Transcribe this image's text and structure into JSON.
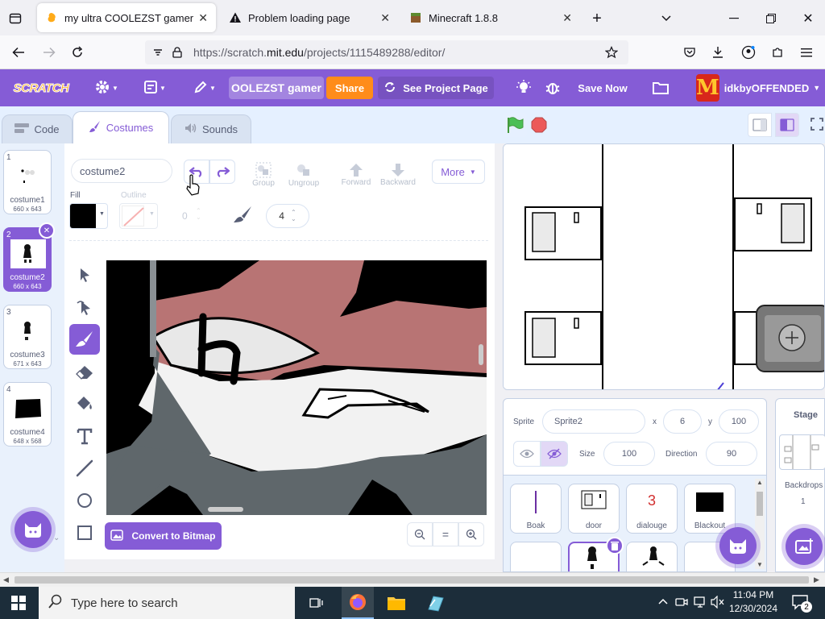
{
  "browser": {
    "tabs": [
      {
        "title": "my ultra COOLEZST gamer on S",
        "active": true
      },
      {
        "title": "Problem loading page",
        "active": false
      },
      {
        "title": "Minecraft 1.8.8",
        "active": false
      }
    ],
    "url_prefix": "https://scratch.",
    "url_domain": "mit.edu",
    "url_suffix": "/projects/1115489288/editor/"
  },
  "menu": {
    "logo": "SCRATCH",
    "project_title": "OOLEZST gamer",
    "share": "Share",
    "see_project_page": "See Project Page",
    "save_now": "Save Now",
    "username": "idkbyOFFENDED",
    "avatar_letter": "M"
  },
  "editor_tabs": {
    "code": "Code",
    "costumes": "Costumes",
    "sounds": "Sounds"
  },
  "costumes": [
    {
      "number": "1",
      "name": "costume1",
      "dims": "660 x 643"
    },
    {
      "number": "2",
      "name": "costume2",
      "dims": "660 x 643"
    },
    {
      "number": "3",
      "name": "costume3",
      "dims": "671 x 643"
    },
    {
      "number": "4",
      "name": "costume4",
      "dims": "648 x 568"
    }
  ],
  "paint": {
    "costume_name": "costume2",
    "group": "Group",
    "ungroup": "Ungroup",
    "forward": "Forward",
    "backward": "Backward",
    "more": "More",
    "fill_label": "Fill",
    "outline_label": "Outline",
    "outline_width": "0",
    "brush_size": "4",
    "convert": "Convert to Bitmap",
    "zoom_reset": "="
  },
  "sprite_info": {
    "sprite_label": "Sprite",
    "sprite_name": "Sprite2",
    "x_label": "x",
    "x": "6",
    "y_label": "y",
    "y": "100",
    "size_label": "Size",
    "size": "100",
    "direction_label": "Direction",
    "direction": "90"
  },
  "sprites": [
    {
      "name": "Boak"
    },
    {
      "name": "door"
    },
    {
      "name": "dialouge",
      "glyph": "3"
    },
    {
      "name": "Blackout"
    }
  ],
  "stage_panel": {
    "title": "Stage",
    "backdrops_label": "Backdrops",
    "backdrops_count": "1"
  },
  "taskbar": {
    "search_placeholder": "Type here to search",
    "time": "11:04 PM",
    "date": "12/30/2024",
    "notifications": "2"
  },
  "colors": {
    "scratch_purple": "#855cd6",
    "share_orange": "#ff8c1a",
    "green_flag": "#4cbf56",
    "stop_red": "#ec5959"
  }
}
